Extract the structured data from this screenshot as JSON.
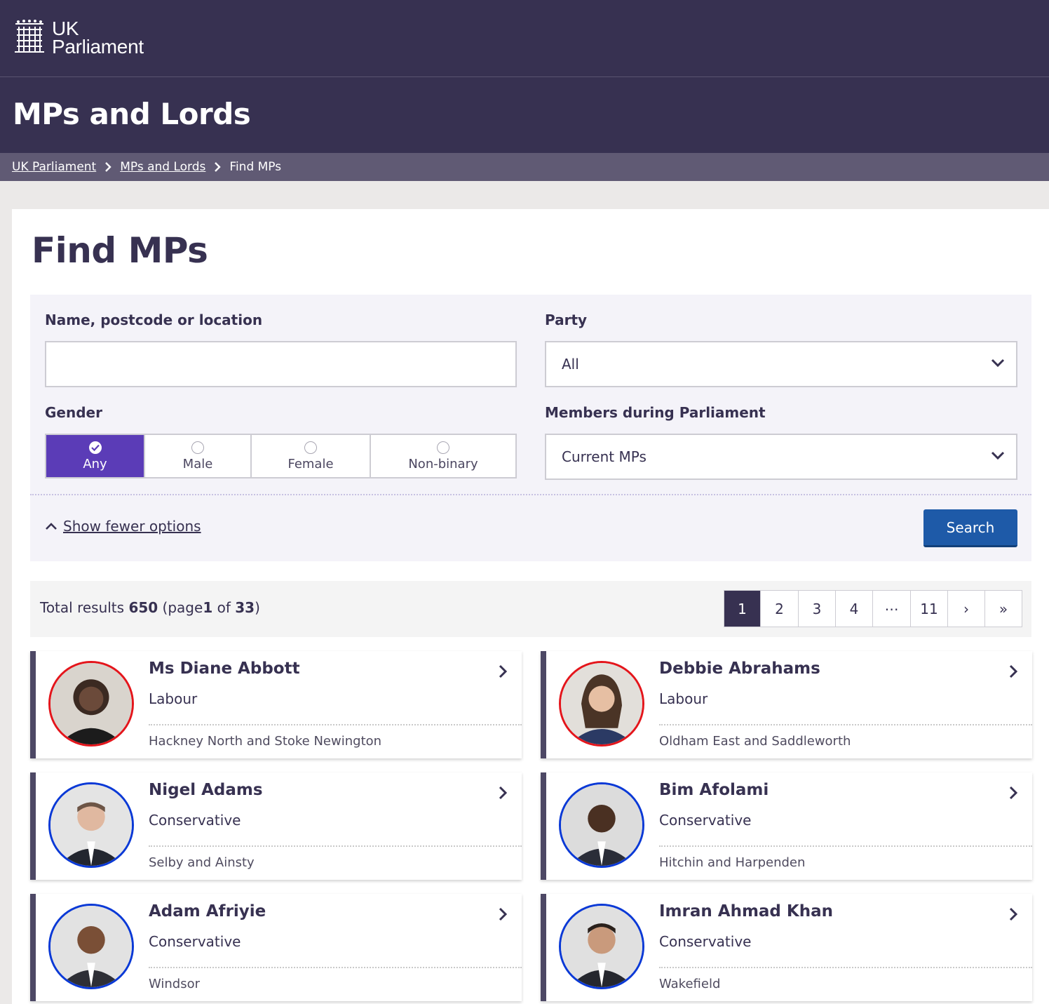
{
  "brand": {
    "line1": "UK",
    "line2": "Parliament"
  },
  "header": {
    "title": "MPs and Lords"
  },
  "breadcrumb": {
    "items": [
      "UK Parliament",
      "MPs and Lords",
      "Find MPs"
    ]
  },
  "page": {
    "heading": "Find MPs"
  },
  "filters": {
    "name_label": "Name, postcode or location",
    "name_value": "",
    "party_label": "Party",
    "party_value": "All",
    "gender_label": "Gender",
    "gender_options": [
      "Any",
      "Male",
      "Female",
      "Non-binary"
    ],
    "gender_selected": "Any",
    "members_label": "Members during Parliament",
    "members_value": "Current MPs",
    "fewer_options": "Show fewer options",
    "search_button": "Search"
  },
  "results": {
    "prefix": "Total results",
    "total": "650",
    "page_prefix": "(page",
    "page": "1",
    "of_word": "of",
    "pages": "33",
    "suffix": ")",
    "pagination": [
      "1",
      "2",
      "3",
      "4",
      "⋯",
      "11",
      "›",
      "»"
    ]
  },
  "colors": {
    "labour": "#e4151b",
    "conservative": "#0a39d6",
    "brand": "#373151",
    "accent": "#5b3cb7",
    "search_button": "#1e5aa8"
  },
  "mps": [
    {
      "name": "Ms Diane Abbott",
      "party": "Labour",
      "constituency": "Hackney North and Stoke Newington"
    },
    {
      "name": "Debbie Abrahams",
      "party": "Labour",
      "constituency": "Oldham East and Saddleworth"
    },
    {
      "name": "Nigel Adams",
      "party": "Conservative",
      "constituency": "Selby and Ainsty"
    },
    {
      "name": "Bim Afolami",
      "party": "Conservative",
      "constituency": "Hitchin and Harpenden"
    },
    {
      "name": "Adam Afriyie",
      "party": "Conservative",
      "constituency": "Windsor"
    },
    {
      "name": "Imran Ahmad Khan",
      "party": "Conservative",
      "constituency": "Wakefield"
    }
  ]
}
